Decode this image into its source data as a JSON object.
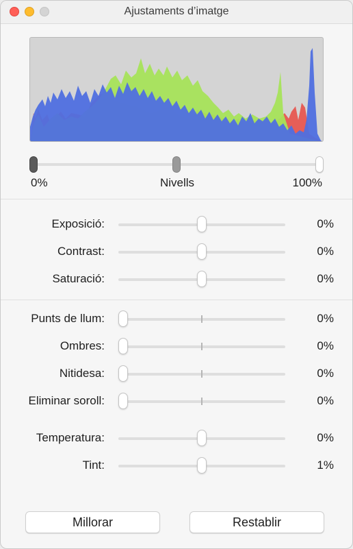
{
  "window": {
    "title": "Ajustaments d’imatge"
  },
  "levels": {
    "min_label": "0%",
    "center_label": "Nivells",
    "max_label": "100%"
  },
  "sliders": [
    {
      "label": "Exposició:",
      "value": "0%",
      "position": 0.5,
      "centered": true
    },
    {
      "label": "Contrast:",
      "value": "0%",
      "position": 0.5,
      "centered": true
    },
    {
      "label": "Saturació:",
      "value": "0%",
      "position": 0.5,
      "centered": true
    },
    {
      "label": "Punts de llum:",
      "value": "0%",
      "position": 0.0,
      "centered": false
    },
    {
      "label": "Ombres:",
      "value": "0%",
      "position": 0.0,
      "centered": false
    },
    {
      "label": "Nitidesa:",
      "value": "0%",
      "position": 0.0,
      "centered": false
    },
    {
      "label": "Eliminar soroll:",
      "value": "0%",
      "position": 0.0,
      "centered": false
    },
    {
      "label": "Temperatura:",
      "value": "0%",
      "position": 0.5,
      "centered": true
    },
    {
      "label": "Tint:",
      "value": "1%",
      "position": 0.5,
      "centered": true
    }
  ],
  "buttons": {
    "enhance": "Millorar",
    "reset": "Restablir"
  },
  "colors": {
    "red_channel": "#e8514a",
    "green_channel": "#a6e35a",
    "blue_channel": "#4f6fe0"
  }
}
